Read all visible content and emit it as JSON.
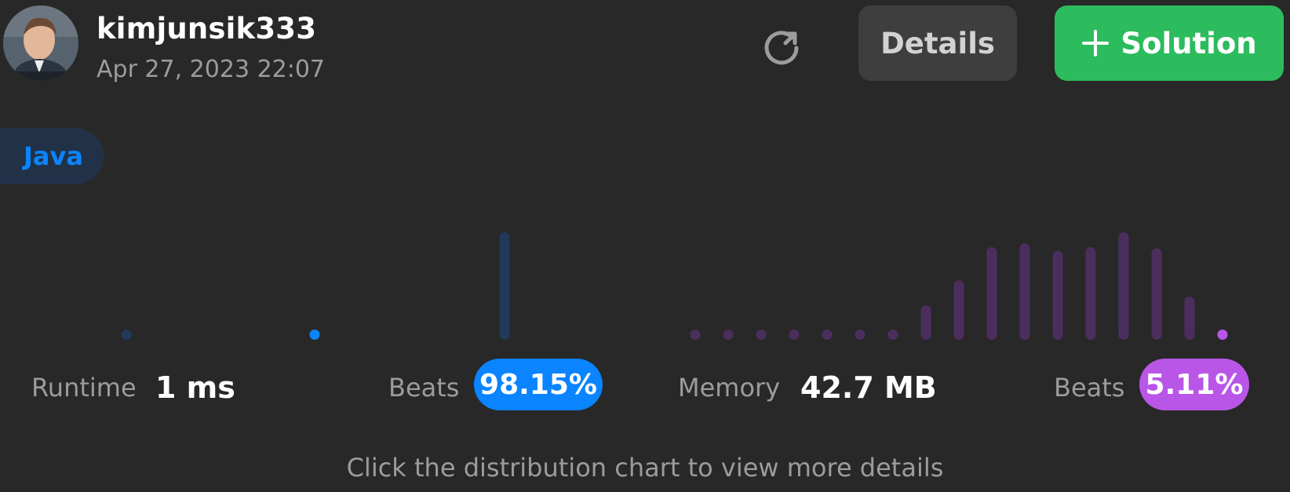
{
  "header": {
    "username": "kimjunsik333",
    "timestamp": "Apr 27, 2023 22:07"
  },
  "actions": {
    "details_label": "Details",
    "solution_label": "Solution"
  },
  "language_tag": "Java",
  "runtime": {
    "label": "Runtime",
    "value": "1 ms",
    "beats_label": "Beats",
    "beats_value": "98.15%"
  },
  "memory": {
    "label": "Memory",
    "value": "42.7 MB",
    "beats_label": "Beats",
    "beats_value": "5.11%"
  },
  "hint": "Click the distribution chart to view more details",
  "colors": {
    "runtime_highlight": "#0a84ff",
    "runtime_bar": "#213a5a",
    "memory_highlight": "#b956e8",
    "memory_bar": "#4c2e5e",
    "solution_button": "#2cbb5d"
  },
  "chart_data": [
    {
      "type": "bar",
      "name": "Runtime distribution",
      "values": [
        1,
        2,
        100
      ],
      "highlight_index": 1
    },
    {
      "type": "bar",
      "name": "Memory distribution",
      "values": [
        1,
        1,
        1,
        1,
        1,
        1,
        2,
        28,
        48,
        75,
        78,
        72,
        75,
        87,
        74,
        35,
        2
      ],
      "highlight_index": 16
    }
  ]
}
